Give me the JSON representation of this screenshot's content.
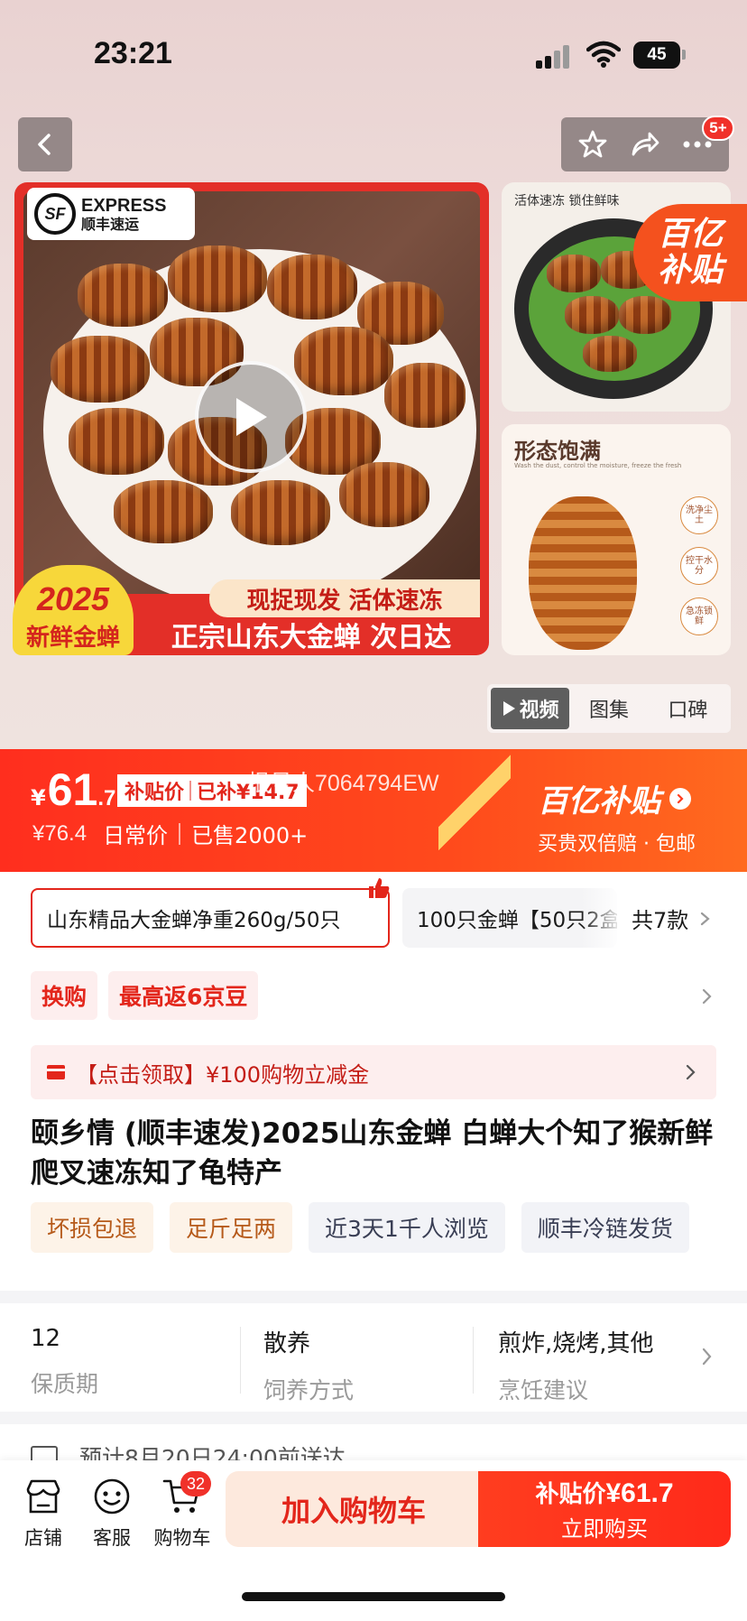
{
  "status": {
    "time": "23:21",
    "battery": "45"
  },
  "header": {
    "cart_badge": "5+"
  },
  "gallery": {
    "sf_en": "EXPRESS",
    "sf_cn": "顺丰速运",
    "year": "2025",
    "year_tag": "新鲜金蝉",
    "banner_top": "现捉现发 活体速冻",
    "banner_main": "正宗山东大金蝉 次日达",
    "thumb1_caption": "活体速冻  锁住鲜味",
    "subsidy_line1": "百亿",
    "subsidy_line2": "补贴",
    "thumb2_title": "形态饱满",
    "thumb2_sub": "Wash the dust, control the moisture, freeze the fresh",
    "thumb2_tags": [
      "洗净尘土",
      "控干水分",
      "急冻锁鲜"
    ],
    "tabs": [
      "视频",
      "图集",
      "口碑"
    ]
  },
  "price": {
    "currency": "¥",
    "integer": "61",
    "decimal": ".7",
    "subsidy_label": "补贴价",
    "subsidy_amount": "已补¥14.7",
    "watermark": "根号人7064794EW",
    "original": "¥76.4",
    "original_label": "日常价",
    "sold": "已售2000+",
    "brand": "百亿补贴",
    "brand_sub": "买贵双倍赔 · 包邮"
  },
  "sku": {
    "selected": "山东精品大金蝉净重260g/50只",
    "other": "100只金蝉【50只2盒",
    "count": "共7款"
  },
  "promos": [
    "换购",
    "最高返6京豆"
  ],
  "coupon": "【点击领取】¥100购物立减金",
  "title": "颐乡情 (顺丰速发)2025山东金蝉 白蝉大个知了猴新鲜爬叉速冻知了龟特产",
  "features": [
    {
      "label": "坏损包退",
      "style": "warm"
    },
    {
      "label": "足斤足两",
      "style": "warm"
    },
    {
      "label": "近3天1千人浏览",
      "style": "cool"
    },
    {
      "label": "顺丰冷链发货",
      "style": "cool"
    }
  ],
  "specs": [
    {
      "value": "12",
      "key": "保质期"
    },
    {
      "value": "散养",
      "key": "饲养方式"
    },
    {
      "value": "煎炸,烧烤,其他",
      "key": "烹饪建议"
    }
  ],
  "delivery": "预计8月20日24:00前送达",
  "bottom": {
    "store": "店铺",
    "service": "客服",
    "cart": "购物车",
    "cart_count": "32",
    "add_cart": "加入购物车",
    "buy_price_label": "补贴价",
    "buy_price": "¥61.7",
    "buy_now": "立即购买"
  },
  "colors": {
    "accent": "#ff2e1e",
    "gold": "#ffd26a"
  }
}
